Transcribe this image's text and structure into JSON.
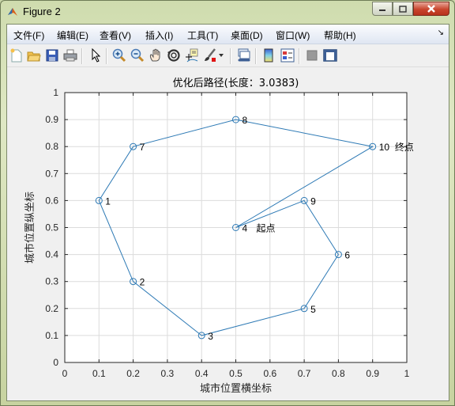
{
  "window": {
    "title": "Figure 2",
    "controls": [
      "minimize",
      "maximize",
      "close"
    ]
  },
  "menubar": {
    "items": [
      {
        "label": "文件(F)"
      },
      {
        "label": "编辑(E)"
      },
      {
        "label": "查看(V)"
      },
      {
        "label": "插入(I)"
      },
      {
        "label": "工具(T)"
      },
      {
        "label": "桌面(D)"
      },
      {
        "label": "窗口(W)"
      },
      {
        "label": "帮助(H)"
      }
    ],
    "dock_icon": "↘"
  },
  "toolbar": {
    "buttons": [
      {
        "icon": "new-figure-icon"
      },
      {
        "icon": "open-file-icon"
      },
      {
        "icon": "save-icon"
      },
      {
        "icon": "print-icon"
      },
      {
        "icon": "pointer-icon"
      },
      {
        "icon": "zoom-in-icon"
      },
      {
        "icon": "zoom-out-icon"
      },
      {
        "icon": "pan-icon"
      },
      {
        "icon": "rotate-3d-icon"
      },
      {
        "icon": "data-cursor-icon"
      },
      {
        "icon": "brush-icon"
      },
      {
        "icon": "link-plot-icon"
      },
      {
        "icon": "colorbar-icon"
      },
      {
        "icon": "legend-icon"
      },
      {
        "icon": "hide-plot-tools-icon"
      },
      {
        "icon": "show-plot-tools-icon"
      }
    ]
  },
  "colors": {
    "line": "#2e7ab5",
    "marker": "#2e7ab5",
    "grid": "#dcdcdc",
    "axes_bg": "#ffffff",
    "figure_bg": "#f0f0f0"
  },
  "chart_data": {
    "type": "line",
    "title": "优化后路径(长度：3.0383)",
    "xlabel": "城市位置横坐标",
    "ylabel": "城市位置纵坐标",
    "xlim": [
      0,
      1
    ],
    "ylim": [
      0,
      1
    ],
    "xticks": [
      "0",
      "0.1",
      "0.2",
      "0.3",
      "0.4",
      "0.5",
      "0.6",
      "0.7",
      "0.8",
      "0.9",
      "1"
    ],
    "yticks": [
      "0",
      "0.1",
      "0.2",
      "0.3",
      "0.4",
      "0.5",
      "0.6",
      "0.7",
      "0.8",
      "0.9",
      "1"
    ],
    "grid": true,
    "marker": "circle",
    "cities": [
      {
        "id": "1",
        "x": 0.1,
        "y": 0.6
      },
      {
        "id": "2",
        "x": 0.2,
        "y": 0.3
      },
      {
        "id": "3",
        "x": 0.4,
        "y": 0.1
      },
      {
        "id": "4",
        "x": 0.5,
        "y": 0.5
      },
      {
        "id": "5",
        "x": 0.7,
        "y": 0.2
      },
      {
        "id": "6",
        "x": 0.8,
        "y": 0.4
      },
      {
        "id": "7",
        "x": 0.2,
        "y": 0.8
      },
      {
        "id": "8",
        "x": 0.5,
        "y": 0.9
      },
      {
        "id": "9",
        "x": 0.7,
        "y": 0.6
      },
      {
        "id": "10",
        "x": 0.9,
        "y": 0.8
      }
    ],
    "route": [
      "4",
      "9",
      "6",
      "5",
      "3",
      "2",
      "1",
      "7",
      "8",
      "10",
      "4"
    ],
    "annotations": [
      {
        "text": "起点",
        "x": 0.56,
        "y": 0.5
      },
      {
        "text": "终点",
        "x": 0.965,
        "y": 0.8
      }
    ]
  }
}
